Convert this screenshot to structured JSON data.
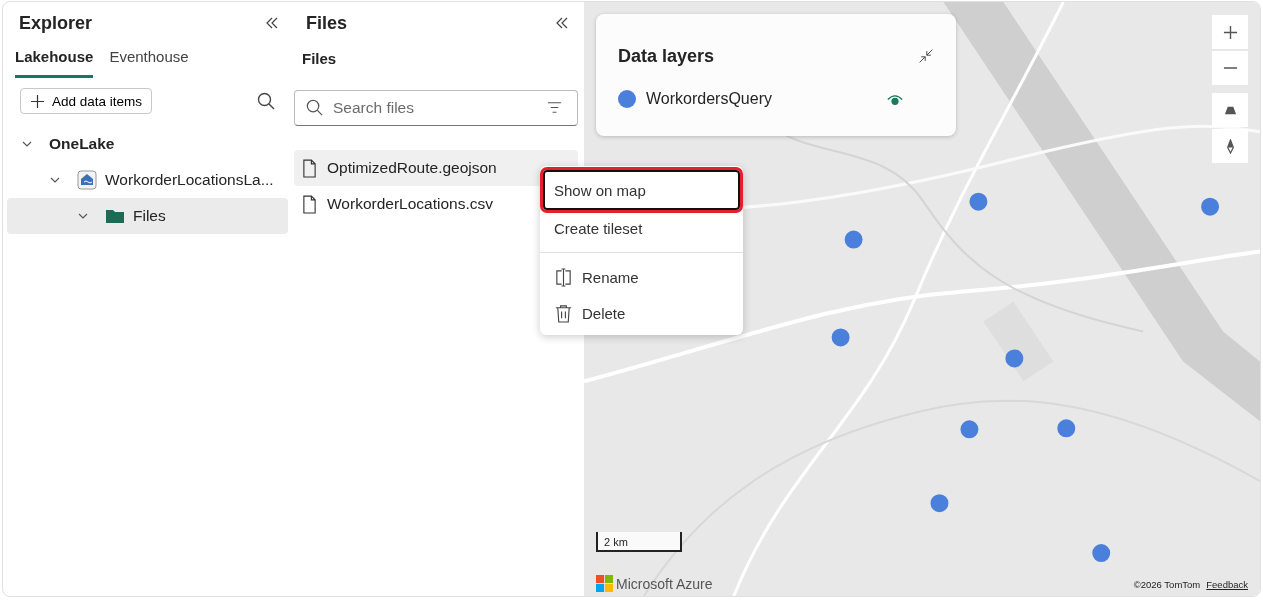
{
  "explorer": {
    "title": "Explorer",
    "tabs": [
      {
        "label": "Lakehouse",
        "selected": true
      },
      {
        "label": "Eventhouse",
        "selected": false
      }
    ],
    "add_button": "Add data items",
    "tree": [
      {
        "label": "OneLake",
        "kind": "root",
        "expanded": true,
        "selected": false,
        "children": [
          {
            "label": "WorkorderLocationsLa...",
            "kind": "lakehouse",
            "expanded": true,
            "selected": false,
            "children": [
              {
                "label": "Files",
                "kind": "folder",
                "expanded": true,
                "selected": true
              }
            ]
          }
        ]
      }
    ]
  },
  "files": {
    "title": "Files",
    "subtitle": "Files",
    "search": {
      "placeholder": "Search files"
    },
    "items": [
      {
        "name": "OptimizedRoute.geojson",
        "selected": true
      },
      {
        "name": "WorkorderLocations.csv",
        "selected": false
      }
    ]
  },
  "context_menu": {
    "items": [
      {
        "label": "Show on map",
        "kind": "plain",
        "focused": true
      },
      {
        "label": "Create tileset",
        "kind": "plain",
        "focused": false
      },
      {
        "label": "Rename",
        "kind": "rename",
        "focused": false
      },
      {
        "label": "Delete",
        "kind": "delete",
        "focused": false
      }
    ]
  },
  "map": {
    "data_layers": {
      "title": "Data layers",
      "layers": [
        {
          "name": "WorkordersQuery",
          "color": "#4a7fdc",
          "visible": true
        }
      ]
    },
    "scale": "2 km",
    "brand": "Microsoft Azure",
    "copyright": "©2026 TomTom",
    "feedback": "Feedback"
  }
}
